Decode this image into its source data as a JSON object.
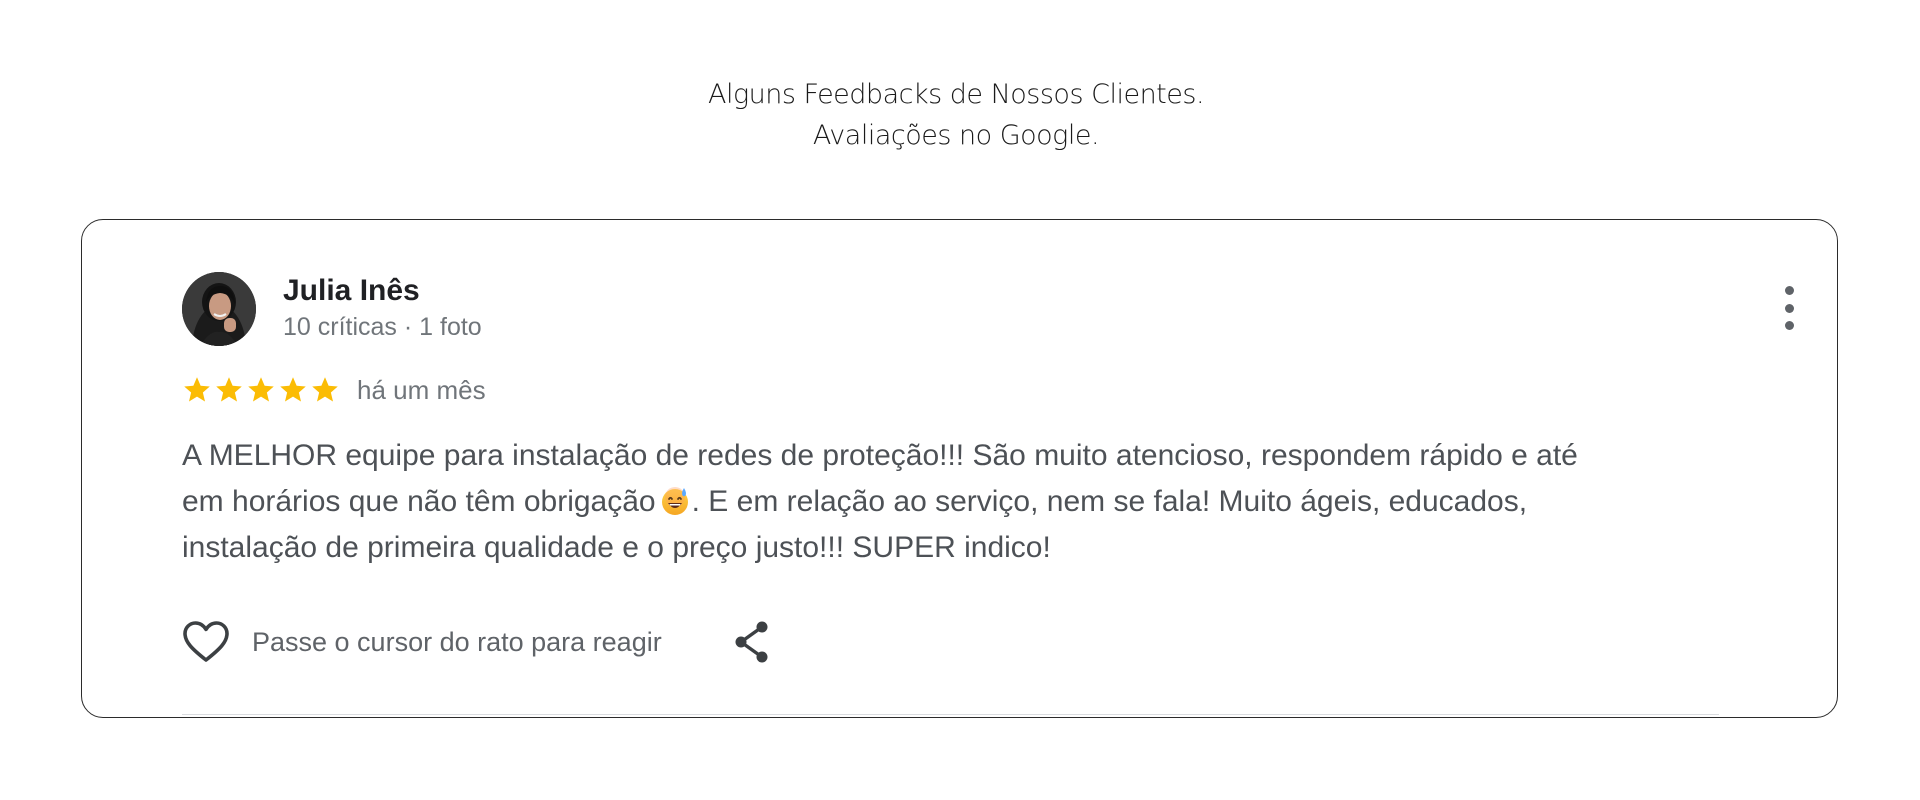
{
  "heading": {
    "line1": "Alguns Feedbacks de Nossos Clientes.",
    "line2": "Avaliações no Google."
  },
  "review": {
    "author_name": "Julia Inês",
    "author_meta": "10 críticas · 1 foto",
    "rating": 5,
    "rating_max": 5,
    "date": "há um mês",
    "text_line1": "A MELHOR equipe para instalação de redes de proteção!!! São muito atencioso, respondem rápido e até",
    "text_line2_before_emoji": "em horários que não têm obrigação",
    "text_line2_after_emoji": ". E em relação ao serviço, nem se fala! Muito ágeis, educados,",
    "text_line3": "instalação de primeira qualidade e o preço justo!!! SUPER indico!",
    "emoji": "grinning-face-with-sweat-emoji"
  },
  "actions": {
    "react_label": "Passe o cursor do rato para reagir",
    "react_icon": "heart-outline-icon",
    "share_icon": "share-icon",
    "more_icon": "more-vertical-icon"
  },
  "colors": {
    "star": "#fbbc04",
    "text": "#4d5156",
    "muted": "#70757a",
    "card_border": "#2b2b2b"
  }
}
